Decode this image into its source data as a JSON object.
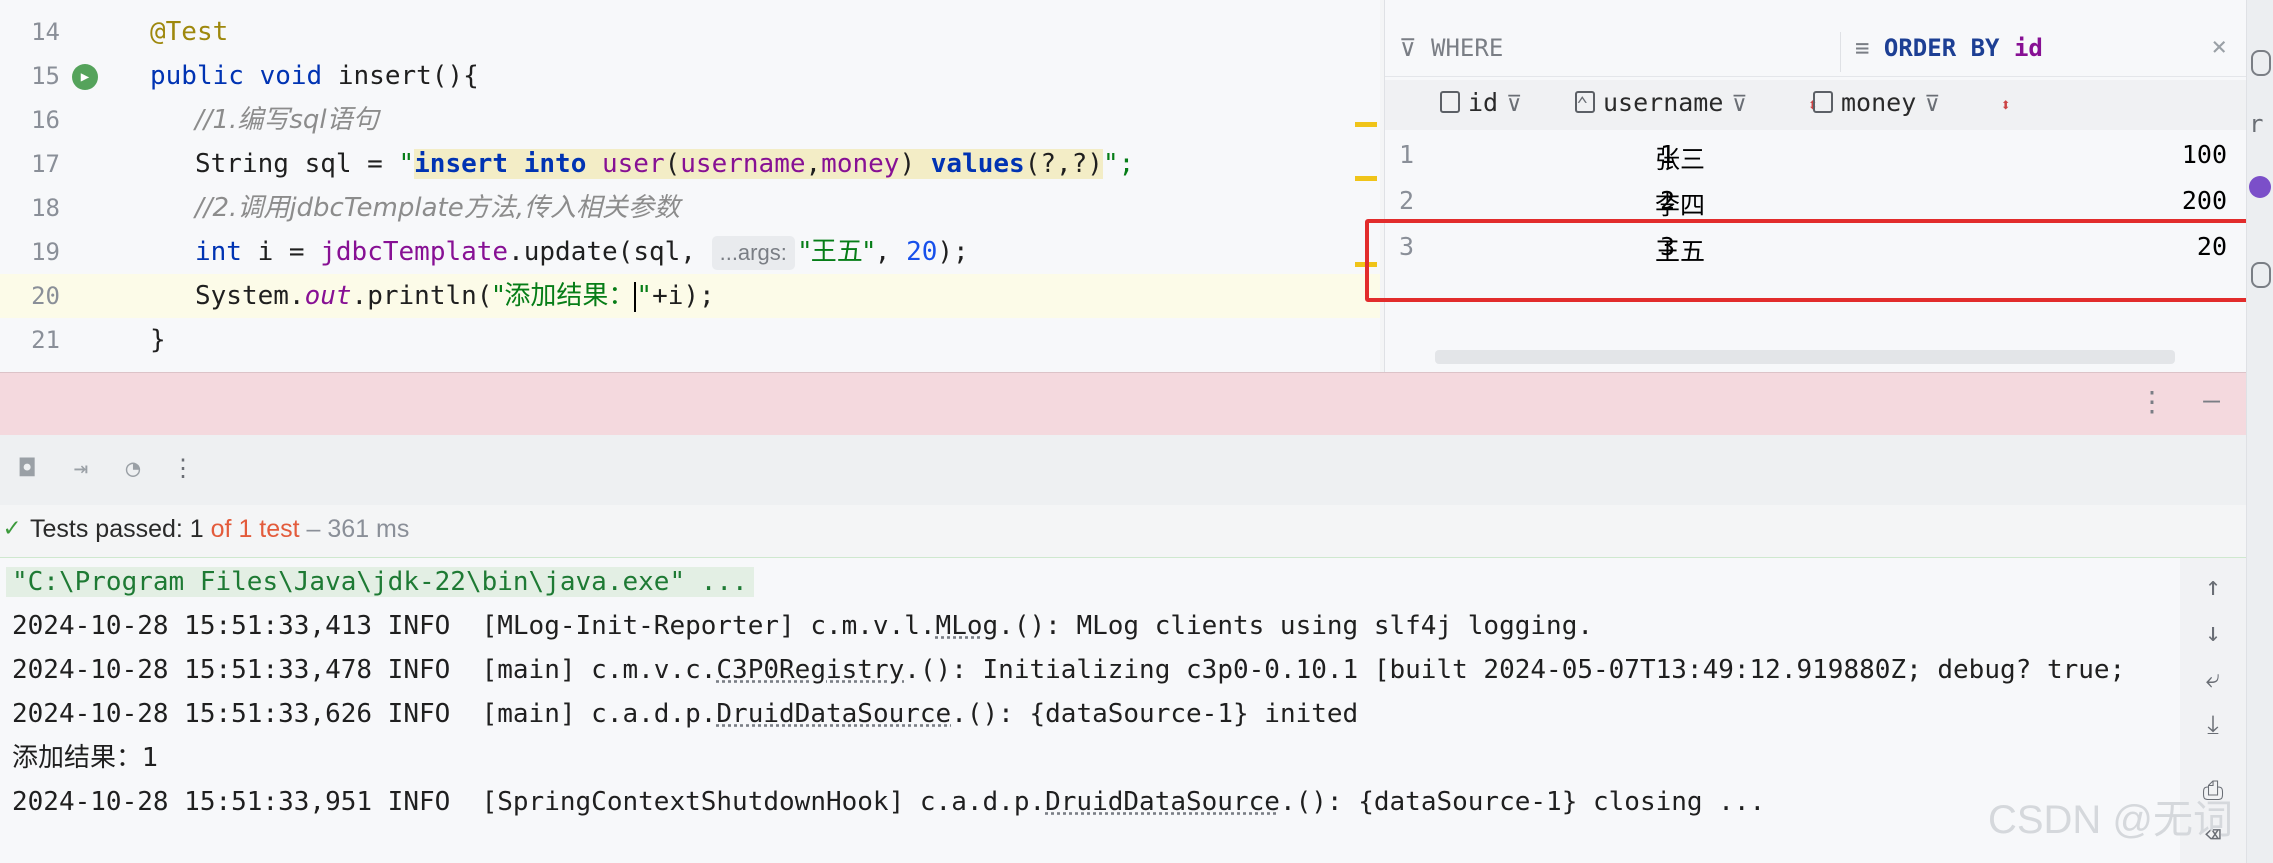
{
  "editor": {
    "line_numbers": [
      "14",
      "15",
      "16",
      "17",
      "18",
      "19",
      "20",
      "21"
    ],
    "lines": {
      "l14": "@Test",
      "l15_kw1": "public",
      "l15_kw2": "void",
      "l15_rest": " insert(){",
      "l16": "//1.编写sql语句",
      "l17_type": "String sql = ",
      "l17_q1": "\"",
      "l17_insert": "insert into",
      "l17_sp1": " ",
      "l17_table": "user",
      "l17_paren1": "(",
      "l17_col1": "username",
      "l17_comma": ",",
      "l17_col2": "money",
      "l17_paren2": ") ",
      "l17_values": "values",
      "l17_params": "(?,?)",
      "l17_q2": "\";",
      "l18": "//2.调用jdbcTemplate方法,传入相关参数",
      "l19_kw": "int",
      "l19_a": " i = ",
      "l19_field": "jdbcTemplate",
      "l19_b": ".update(sql, ",
      "l19_inlay": "...args:",
      "l19_str": "\"王五\"",
      "l19_c": ", ",
      "l19_num": "20",
      "l19_d": ");",
      "l20_a": "System.",
      "l20_out": "out",
      "l20_b": ".println(",
      "l20_str1": "\"添加结果：",
      "l20_str2": "\"",
      "l20_c": "+i);",
      "l21": "}"
    }
  },
  "grid": {
    "where_label": "WHERE",
    "orderby_kw": "ORDER BY",
    "orderby_col": "id",
    "close": "×",
    "columns": [
      "id",
      "username",
      "money"
    ],
    "rows": [
      {
        "num": "1",
        "id": "1",
        "username": "张三",
        "money": "100"
      },
      {
        "num": "2",
        "id": "2",
        "username": "李四",
        "money": "200"
      },
      {
        "num": "3",
        "id": "3",
        "username": "王五",
        "money": "20"
      }
    ]
  },
  "panel": {
    "more": "⋮",
    "minimize": "—"
  },
  "status": {
    "check": "✓",
    "prefix": "Tests passed: 1 ",
    "of": "of 1 test",
    "time": " – 361 ms"
  },
  "console": {
    "cmd": "\"C:\\Program Files\\Java\\jdk-22\\bin\\java.exe\" ...",
    "log1_a": "2024-10-28 15:51:33,413 INFO  [MLog-Init-Reporter] c.m.v.l.",
    "log1_u": "MLog",
    "log1_b": ".(): MLog clients using slf4j logging.",
    "log2_a": "2024-10-28 15:51:33,478 INFO  [main] c.m.v.c.",
    "log2_u": "C3P0Registry",
    "log2_b": ".(): Initializing c3p0-0.10.1 [built 2024-05-07T13:49:12.919880Z; debug? true;",
    "log3_a": "2024-10-28 15:51:33,626 INFO  [main] c.a.d.p.",
    "log3_u": "DruidDataSource",
    "log3_b": ".(): {dataSource-1} inited",
    "result": "添加结果：1",
    "log4_a": "2024-10-28 15:51:33,951 INFO  [SpringContextShutdownHook] c.a.d.p.",
    "log4_u": "DruidDataSource",
    "log4_b": ".(): {dataSource-1} closing ..."
  },
  "watermark": "CSDN @无词",
  "icons": {
    "run_gutter": "run-test-icon",
    "camera": "camera-icon",
    "export": "export-icon",
    "gauge": "gauge-icon",
    "more": "more-icon",
    "up": "arrow-up-icon",
    "down": "arrow-down-icon",
    "wrap": "soft-wrap-icon",
    "scroll_end": "scroll-to-end-icon",
    "print": "print-icon",
    "trash": "trash-icon"
  },
  "colors": {
    "highlight_box": "#e22c2c",
    "test_pass": "#3c9a3c",
    "pink_bar": "#f4d9de"
  }
}
